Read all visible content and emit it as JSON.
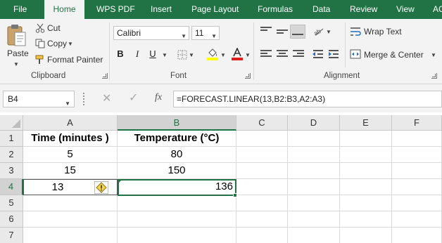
{
  "tabs": [
    "File",
    "Home",
    "WPS PDF",
    "Insert",
    "Page Layout",
    "Formulas",
    "Data",
    "Review",
    "View",
    "AC"
  ],
  "colors": {
    "brand": "#217346",
    "ribbon": "#f3f3f3"
  },
  "clipboard": {
    "paste": "Paste",
    "cut": "Cut",
    "copy": "Copy",
    "format_painter": "Format Painter",
    "group_label": "Clipboard"
  },
  "font": {
    "name": "Calibri",
    "size": "11",
    "bold": "B",
    "italic": "I",
    "underline": "U",
    "group_label": "Font"
  },
  "alignment": {
    "wrap_text": "Wrap Text",
    "merge_center": "Merge & Center",
    "group_label": "Alignment"
  },
  "formula_bar": {
    "name_box": "B4",
    "fx": "fx",
    "formula": "=FORECAST.LINEAR(13,B2:B3,A2:A3)"
  },
  "sheet": {
    "columns": [
      "A",
      "B",
      "C",
      "D",
      "E",
      "F"
    ],
    "rows": [
      "1",
      "2",
      "3",
      "4",
      "5",
      "6",
      "7"
    ],
    "a1": "Time (minutes )",
    "b1": "Temperature (°C)",
    "a2": "5",
    "b2": "80",
    "a3": "15",
    "b3": "150",
    "a4": "13",
    "b4": "136"
  },
  "icons": [
    "paste-icon",
    "cut-icon",
    "copy-icon",
    "format-painter-icon",
    "borders-icon",
    "fill-color-icon",
    "font-color-icon",
    "orientation-icon",
    "wrap-text-icon",
    "merge-center-icon",
    "cancel-icon",
    "enter-icon",
    "error-check-icon"
  ]
}
